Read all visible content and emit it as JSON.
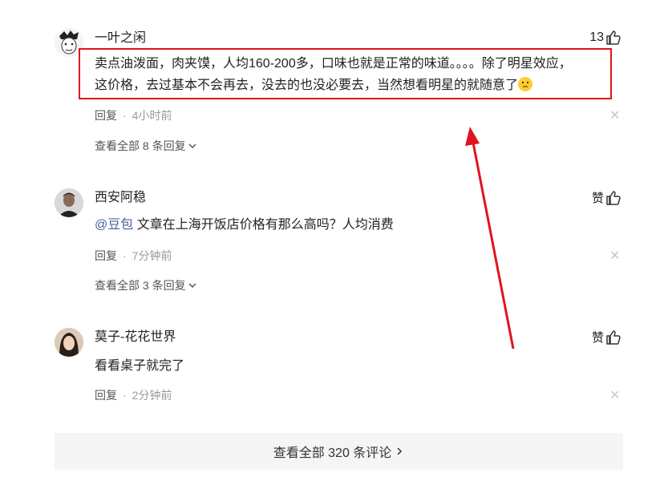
{
  "comments": [
    {
      "username": "一叶之闲",
      "likes": "13",
      "text_line1": "卖点油泼面，肉夹馍，人均160-200多，口味也就是正常的味道。。。。除了明星效应，",
      "text_line2": "这价格，去过基本不会再去，没去的也没必要去，当然想看明星的就随意了",
      "emoji": "thinking-face-emoji",
      "reply_label": "回复",
      "time": "4小时前",
      "more_replies": "查看全部 8 条回复"
    },
    {
      "username": "西安阿稳",
      "likes": "赞",
      "mention": "@豆包",
      "text": " 文章在上海开饭店价格有那么高吗？人均消费",
      "reply_label": "回复",
      "time": "7分钟前",
      "more_replies": "查看全部 3 条回复"
    },
    {
      "username": "莫子-花花世界",
      "likes": "赞",
      "text": "看看桌子就完了",
      "reply_label": "回复",
      "time": "2分钟前"
    }
  ],
  "footer": {
    "label": "查看全部 320 条评论"
  },
  "annotation": {
    "color": "#e0141e"
  }
}
